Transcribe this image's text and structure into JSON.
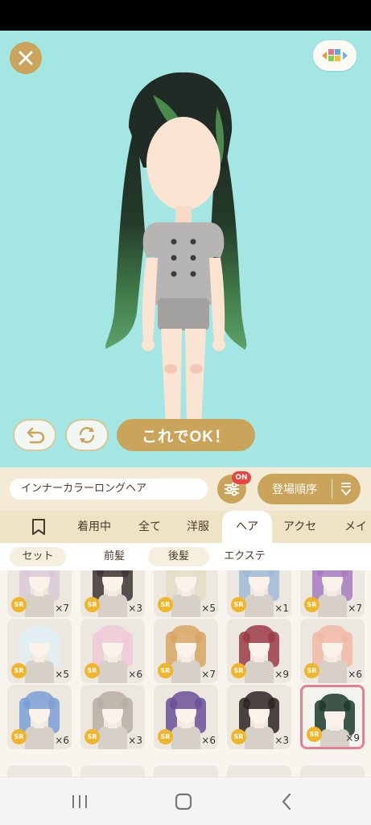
{
  "editor": {
    "confirm_label": "これでOK！"
  },
  "toolbar": {
    "item_name": "インナーカラーロングヘア",
    "filter_badge": "ON",
    "sort_label": "登場順序"
  },
  "tabs": [
    "着用中",
    "全て",
    "洋服",
    "ヘア",
    "アクセ",
    "メイ"
  ],
  "subtabs": [
    "セット",
    "前髪",
    "後髪",
    "エクステ"
  ],
  "rarity_label": "SR",
  "grid": [
    {
      "count": "×7",
      "hair": "#d9c9d6"
    },
    {
      "count": "×3",
      "hair": "#3b3234"
    },
    {
      "count": "×5",
      "hair": "#e4dcc4"
    },
    {
      "count": "×1",
      "hair": "#9fb9d8"
    },
    {
      "count": "×7",
      "hair": "#a67bbf"
    },
    {
      "count": "×5",
      "hair": "#dfeef5"
    },
    {
      "count": "×6",
      "hair": "#efc9d8"
    },
    {
      "count": "×7",
      "hair": "#d7a663"
    },
    {
      "count": "×9",
      "hair": "#9a3a48"
    },
    {
      "count": "×6",
      "hair": "#f2b9a8"
    },
    {
      "count": "×6",
      "hair": "#7a9fd6"
    },
    {
      "count": "×3",
      "hair": "#b8aea3"
    },
    {
      "count": "×6",
      "hair": "#6a5098"
    },
    {
      "count": "×3",
      "hair": "#2c2424"
    },
    {
      "count": "×9",
      "hair": "#1e3a2c"
    }
  ]
}
